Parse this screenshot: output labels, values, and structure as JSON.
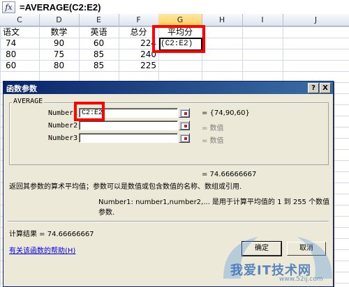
{
  "formula_bar": {
    "fx_label": "fx",
    "formula": "=AVERAGE(C2:E2)"
  },
  "columns": [
    "C",
    "D",
    "E",
    "F",
    "G",
    "H",
    "I",
    "J"
  ],
  "rows": [
    [
      "语文",
      "数学",
      "英语",
      "总分",
      "平均分"
    ],
    [
      "74",
      "90",
      "60",
      "224",
      ""
    ],
    [
      "80",
      "75",
      "85",
      "240",
      ""
    ],
    [
      "60",
      "80",
      "85",
      "225",
      ""
    ]
  ],
  "active_cell_text": "(C2:E2)",
  "dialog": {
    "title": "函数参数",
    "help_btn": "?",
    "close_btn": "X",
    "function_name": "AVERAGE",
    "args": [
      {
        "label": "Number1",
        "value": "C2:E2",
        "result": "= {74,90,60}"
      },
      {
        "label": "Number2",
        "value": "",
        "result": "= 数值"
      },
      {
        "label": "Number3",
        "value": "",
        "result": "= 数值"
      }
    ],
    "overall_result": "= 74.66666667",
    "description": "返回其参数的算术平均值；参数可以是数值或包含数值的名称、数组或引用.",
    "arg_help": "Number1:  number1,number2,... 是用于计算平均值的 1 到 255 个数值参数.",
    "calc_result": "计算结果 =  74.66666667",
    "help_link": "有关该函数的帮助(H)",
    "ok": "确定",
    "cancel": "取消"
  },
  "watermark": {
    "text": "我爱IT技术网",
    "url": "www.52ij.com"
  }
}
